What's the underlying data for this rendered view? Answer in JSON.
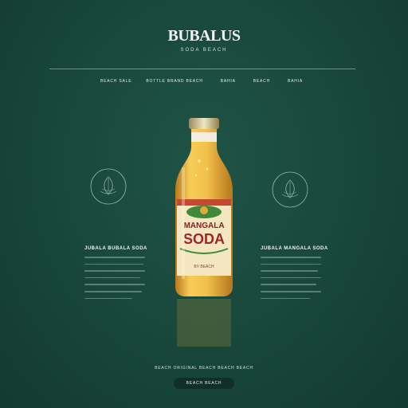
{
  "brand": {
    "title": "BUBALUS",
    "subtitle": "SODA BEACH"
  },
  "nav": [
    "BEACH SALE",
    "BOTTLE BRAND BEACH",
    "BAHIA",
    "BEACH",
    "BAHIA"
  ],
  "product": {
    "label_line1": "MANGALA",
    "label_line2": "SODA",
    "label_small": "BY BEACH"
  },
  "left_column": {
    "heading": "JUBALA BUBALA SODA",
    "accent": "SODA"
  },
  "right_column": {
    "heading": "JUBALA MANGALA SODA",
    "accent": "SODA"
  },
  "footer": {
    "text": "BEACH ORIGINAL BEACH BEACH BEACH",
    "cta": "BEACH BEACH"
  },
  "colors": {
    "background": "#18463a",
    "accent": "#8fc98b",
    "bottle": "#e9b23a"
  }
}
